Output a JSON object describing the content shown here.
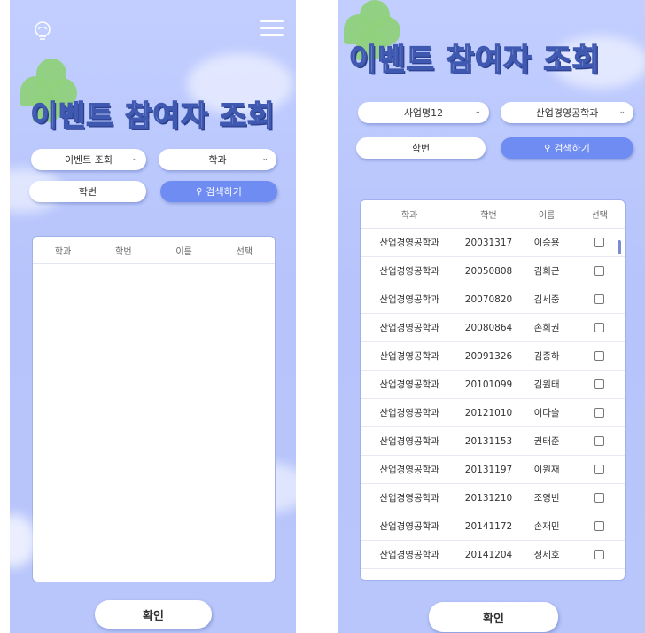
{
  "left": {
    "title": "이벤트 참여자 조회",
    "event_select": "이벤트 조회",
    "dept_select": "학과",
    "student_id_button": "학번",
    "search_button": "검색하기",
    "table": {
      "headers": [
        "학과",
        "학번",
        "이름",
        "선택"
      ]
    },
    "confirm": "확인"
  },
  "right": {
    "title": "이벤트 참여자 조회",
    "business_select": "사업명12",
    "dept_select": "산업경영공학과",
    "student_id_button": "학번",
    "search_button": "검색하기",
    "table": {
      "headers": [
        "학과",
        "학번",
        "이름",
        "선택"
      ],
      "rows": [
        [
          "산업경영공학과",
          "20031317",
          "이승용"
        ],
        [
          "산업경영공학과",
          "20050808",
          "김희근"
        ],
        [
          "산업경영공학과",
          "20070820",
          "김세중"
        ],
        [
          "산업경영공학과",
          "20080864",
          "손희권"
        ],
        [
          "산업경영공학과",
          "20091326",
          "김종하"
        ],
        [
          "산업경영공학과",
          "20101099",
          "김원태"
        ],
        [
          "산업경영공학과",
          "20121010",
          "이다슬"
        ],
        [
          "산업경영공학과",
          "20131153",
          "권태준"
        ],
        [
          "산업경영공학과",
          "20131197",
          "이원재"
        ],
        [
          "산업경영공학과",
          "20131210",
          "조영빈"
        ],
        [
          "산업경영공학과",
          "20141172",
          "손재민"
        ],
        [
          "산업경영공학과",
          "20141204",
          "정세호"
        ]
      ]
    },
    "confirm": "확인"
  },
  "icons": {
    "logo": "lightbulb-outline-icon",
    "menu": "hamburger-menu-icon",
    "search": "magnifier-icon",
    "dropdown": "chevron-down-icon"
  },
  "colors": {
    "background": "#b8c6fb",
    "accent": "#6f8cf3",
    "title_outline": "#3f58b0"
  }
}
